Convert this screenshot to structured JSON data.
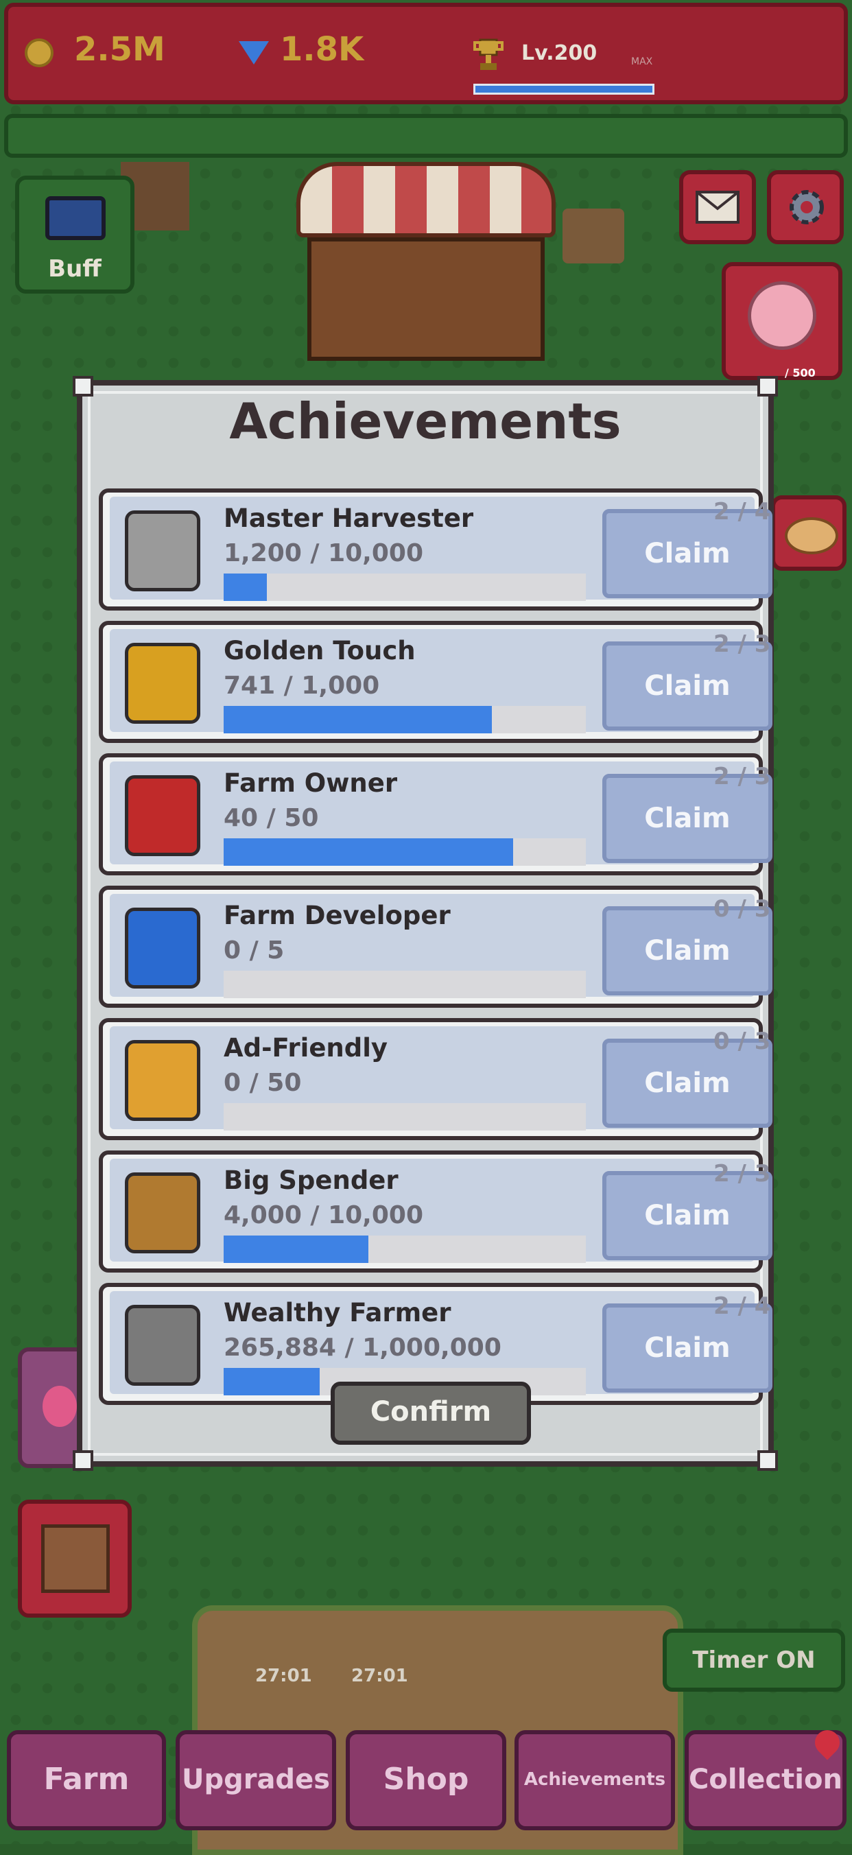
{
  "resources": {
    "coins": "2.5M",
    "gems": "1.8K",
    "level": "Lv.200",
    "level_max": "MAX"
  },
  "buff": {
    "label": "Buff"
  },
  "piggy": {
    "value": "/ 500"
  },
  "timer": {
    "label": "Timer ON"
  },
  "field_timers": [
    "27:01",
    "27:01"
  ],
  "dialog": {
    "title": "Achievements",
    "confirm_label": "Confirm",
    "claim_label": "Claim",
    "rows": [
      {
        "name": "Master Harvester",
        "progress": "1,200 / 10,000",
        "fraction": 0.12,
        "count": "2 / 4",
        "icon": "pickaxe-wheat-icon"
      },
      {
        "name": "Golden Touch",
        "progress": "741 / 1,000",
        "fraction": 0.741,
        "count": "2 / 3",
        "icon": "gold-chest-icon"
      },
      {
        "name": "Farm Owner",
        "progress": "40 / 50",
        "fraction": 0.8,
        "count": "2 / 3",
        "icon": "barn-icon"
      },
      {
        "name": "Farm Developer",
        "progress": "0 / 5",
        "fraction": 0,
        "count": "0 / 3",
        "icon": "blueprint-icon"
      },
      {
        "name": "Ad-Friendly",
        "progress": "0 / 50",
        "fraction": 0,
        "count": "0 / 3",
        "icon": "farmer-ad-icon"
      },
      {
        "name": "Big Spender",
        "progress": "4,000 / 10,000",
        "fraction": 0.4,
        "count": "2 / 3",
        "icon": "money-bag-cart-icon"
      },
      {
        "name": "Wealthy Farmer",
        "progress": "265,884 / 1,000,000",
        "fraction": 0.265884,
        "count": "2 / 4",
        "icon": "hammer-wrench-icon"
      }
    ]
  },
  "nav": {
    "farm": "Farm",
    "upgrades": "Upgrades",
    "shop": "Shop",
    "achievements": "Achievements",
    "collection": "Collection"
  },
  "colors": {
    "progress_fill": "#3e82e4",
    "claim_bg": "#9fb0d4",
    "topbar": "#9b2230",
    "nav": "#8a3a6a"
  }
}
